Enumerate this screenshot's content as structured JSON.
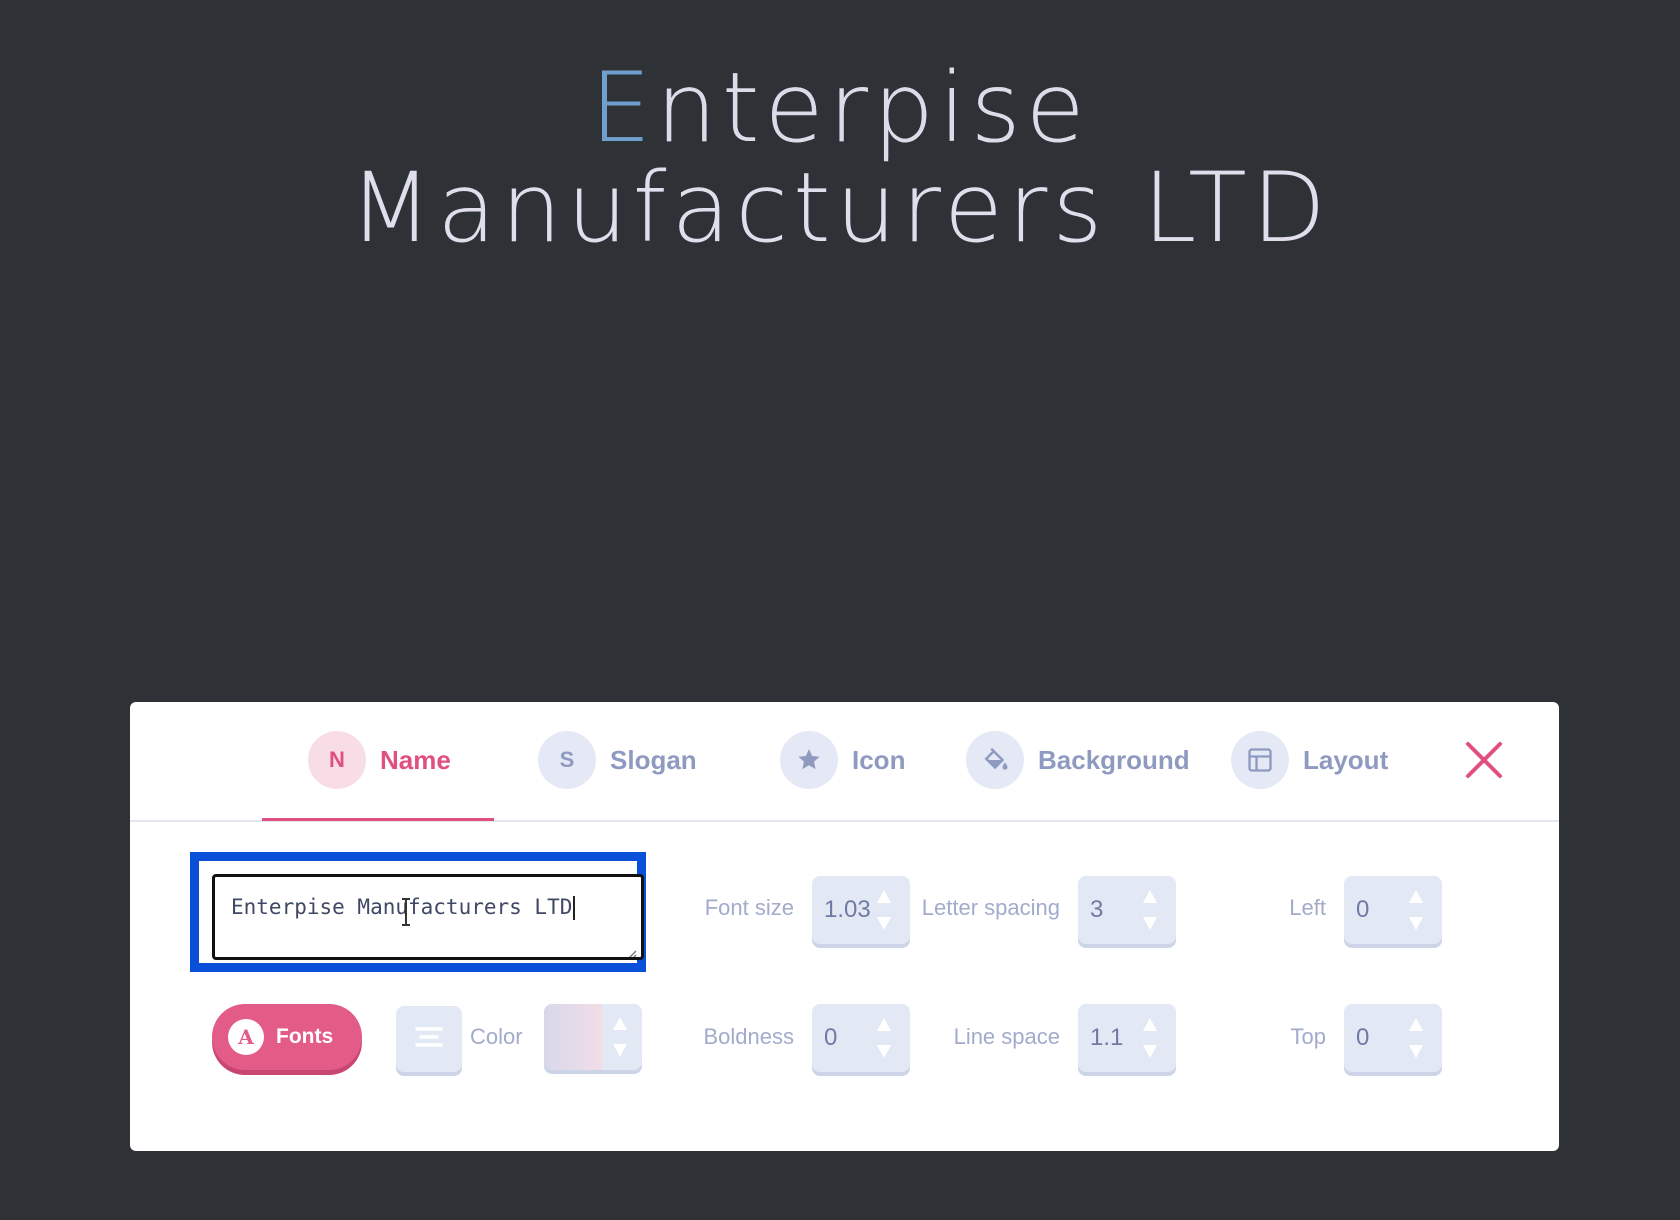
{
  "logo": {
    "line1_first": "E",
    "line1_rest": "nterpise",
    "line2": "Manufacturers LTD",
    "accent_color": "#6e9fcf"
  },
  "tabs": [
    {
      "initial": "N",
      "label": "Name",
      "active": true
    },
    {
      "initial": "S",
      "label": "Slogan",
      "active": false
    },
    {
      "icon": "star-icon",
      "label": "Icon",
      "active": false
    },
    {
      "icon": "paint-bucket-icon",
      "label": "Background",
      "active": false
    },
    {
      "icon": "layout-icon",
      "label": "Layout",
      "active": false
    }
  ],
  "name_input": {
    "value": "Enterpise Manufacturers LTD"
  },
  "controls": {
    "font_size": {
      "label": "Font size",
      "value": "1.03"
    },
    "letter_spacing": {
      "label": "Letter spacing",
      "value": "3"
    },
    "left": {
      "label": "Left",
      "value": "0"
    },
    "boldness": {
      "label": "Boldness",
      "value": "0"
    },
    "line_space": {
      "label": "Line space",
      "value": "1.1"
    },
    "top": {
      "label": "Top",
      "value": "0"
    }
  },
  "fonts_button": {
    "icon_letter": "A",
    "label": "Fonts"
  },
  "color": {
    "label": "Color"
  },
  "colors": {
    "active_accent": "#e0507e",
    "highlight_border": "#0a4fd8",
    "tab_inactive": "#8f9ac0"
  }
}
